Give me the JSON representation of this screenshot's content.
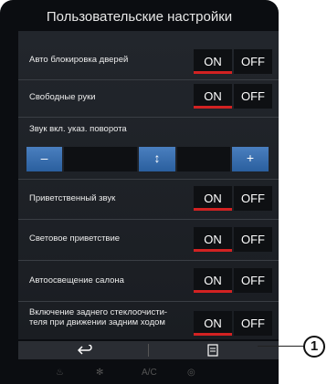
{
  "title": "Пользовательские настройки",
  "rows": [
    {
      "label": "Авто блокировка дверей",
      "on": "ON",
      "off": "OFF"
    },
    {
      "label": "Свободные руки",
      "on": "ON",
      "off": "OFF"
    },
    {
      "label": "Звук вкл. указ. поворота"
    },
    {
      "label": "Приветственный звук",
      "on": "ON",
      "off": "OFF"
    },
    {
      "label": "Световое приветствие",
      "on": "ON",
      "off": "OFF"
    },
    {
      "label": "Автоосвещение салона",
      "on": "ON",
      "off": "OFF"
    },
    {
      "label1": "Включение заднего стеклоочисти-",
      "label2": "теля при движении задним ходом",
      "on": "ON",
      "off": "OFF"
    }
  ],
  "stepper": {
    "minus": "–",
    "mid": "↕",
    "plus": "+"
  },
  "bottom": {
    "back_icon": "back-arrow-icon",
    "save_icon": "save-icon"
  },
  "dock_icons": [
    "seat-heat-icon",
    "fan-icon",
    "ac-icon",
    "settings-icon"
  ],
  "dock_ac_label": "A/C",
  "callout": "1"
}
